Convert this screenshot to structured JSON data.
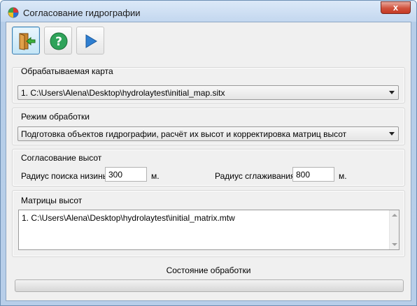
{
  "window": {
    "title": "Согласование гидрографии",
    "close_label": "x"
  },
  "toolbar": {
    "buttons": [
      {
        "name": "exit",
        "icon": "exit-door-icon"
      },
      {
        "name": "help",
        "icon": "help-icon"
      },
      {
        "name": "run",
        "icon": "play-icon"
      }
    ]
  },
  "map_group": {
    "label": "Обрабатываемая карта",
    "selected": "1. C:\\Users\\Alena\\Desktop\\hydrolaytest\\initial_map.sitx"
  },
  "mode_group": {
    "label": "Режим обработки",
    "selected": "Подготовка объектов гидрографии, расчёт их высот и корректировка матриц высот"
  },
  "heights_group": {
    "label": "Согласование высот",
    "search_radius_label": "Радиус поиска низины",
    "search_radius_value": "300",
    "search_radius_unit": "м.",
    "smoothing_radius_label": "Радиус сглаживания",
    "smoothing_radius_value": "800",
    "smoothing_radius_unit": "м."
  },
  "matrices_group": {
    "label": "Матрицы высот",
    "items": [
      "1. C:\\Users\\Alena\\Desktop\\hydrolaytest\\initial_matrix.mtw"
    ]
  },
  "status": {
    "label": "Состояние обработки",
    "progress": 0
  },
  "colors": {
    "accent": "#3c7fb1",
    "help_green": "#2fa35a",
    "play_blue": "#2f7fd1"
  }
}
